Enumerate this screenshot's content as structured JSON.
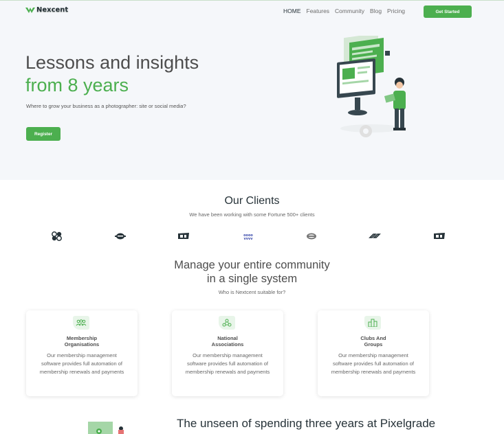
{
  "brand": {
    "name": "Nexcent",
    "accent": "#4caf4f",
    "text": "#263238"
  },
  "nav": {
    "items": [
      {
        "label": "HOME",
        "active": true
      },
      {
        "label": "Features",
        "active": false
      },
      {
        "label": "Community",
        "active": false
      },
      {
        "label": "Blog",
        "active": false
      },
      {
        "label": "Pricing",
        "active": false
      }
    ],
    "cta_label": "Get Started"
  },
  "hero": {
    "title_line1": "Lessons and insights",
    "title_line2": "from 8 years",
    "subtitle": "Where to grow your business as a photographer: site or social media?",
    "button_label": "Register",
    "illustration": "developer-at-monitor-illustration"
  },
  "clients": {
    "title": "Our Clients",
    "subtitle": "We have been working with some Fortune 500+ clients",
    "logos": [
      "client-logo-1-icon",
      "client-logo-2-icon",
      "client-logo-3-icon",
      "client-logo-4-icon",
      "client-logo-5-icon",
      "client-logo-6-icon",
      "client-logo-7-icon"
    ]
  },
  "community": {
    "title_line1": "Manage your entire community",
    "title_line2": "in a single system",
    "subtitle": "Who is Nextcent suitable for?",
    "cards": [
      {
        "title_line1": "Membership",
        "title_line2": "Organisations",
        "icon": "people-group-icon",
        "body_line1": "Our membership management",
        "body_line2": "software provides full automation of",
        "body_line3": "membership renewals and payments"
      },
      {
        "title_line1": "National",
        "title_line2": "Associations",
        "icon": "network-icon",
        "body_line1": "Our membership management",
        "body_line2": "software provides full automation of",
        "body_line3": "membership renewals and payments"
      },
      {
        "title_line1": "Clubs And",
        "title_line2": "Groups",
        "icon": "building-icon",
        "body_line1": "Our membership management",
        "body_line2": "software provides full automation of",
        "body_line3": "membership renewals and payments"
      }
    ]
  },
  "feature": {
    "title": "The unseen of spending three years at Pixelgrade"
  }
}
